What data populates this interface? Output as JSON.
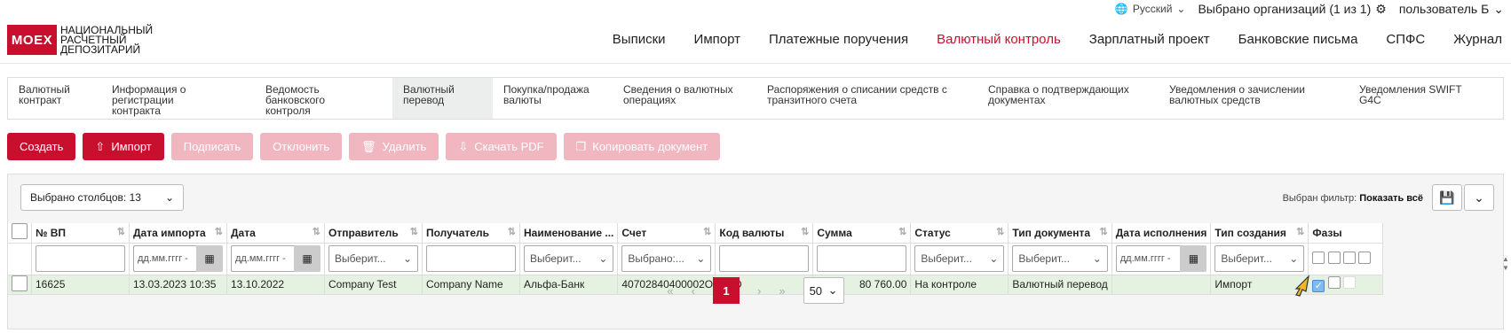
{
  "topbar": {
    "language": "Русский",
    "org_selected": "Выбрано организаций (1 из 1)",
    "user": "пользователь Б"
  },
  "logo": {
    "mark": "MOEX",
    "line1": "Национальный",
    "line2": "расчетный",
    "line3": "депозитарий"
  },
  "nav": [
    "Выписки",
    "Импорт",
    "Платежные поручения",
    "Валютный контроль",
    "Зарплатный проект",
    "Банковские письма",
    "СПФС",
    "Журнал"
  ],
  "tabs": [
    {
      "line1": "Валютный",
      "line2": "контракт"
    },
    {
      "line1": "Информация о регистрации",
      "line2": "контракта"
    },
    {
      "line1": "Ведомость банковского",
      "line2": "контроля"
    },
    {
      "line1": "Валютный",
      "line2": "перевод"
    },
    {
      "line1": "Покупка/продажа",
      "line2": "валюты"
    },
    {
      "line1": "Сведения о валютных",
      "line2": "операциях"
    },
    {
      "line1": "Распоряжения о списании средств с",
      "line2": "транзитного счета"
    },
    {
      "line1": "Справка о подтверждающих",
      "line2": "документах"
    },
    {
      "line1": "Уведомления о зачислении",
      "line2": "валютных средств"
    },
    {
      "line1": "Уведомления SWIFT",
      "line2": "G4C"
    }
  ],
  "toolbar": {
    "create": "Создать",
    "import": "Импорт",
    "sign": "Подписать",
    "reject": "Отклонить",
    "delete": "Удалить",
    "pdf": "Скачать PDF",
    "copy": "Копировать документ"
  },
  "grid": {
    "columns_selected": "Выбрано столбцов: 13",
    "filter_label": "Выбран фильтр:",
    "filter_value": "Показать всё",
    "headers": [
      "№ ВП",
      "Дата импорта",
      "Дата",
      "Отправитель",
      "Получатель",
      "Наименование ...",
      "Счет",
      "Код валюты",
      "Сумма",
      "Статус",
      "Тип документа",
      "Дата исполнения",
      "Тип создания",
      "Фазы"
    ],
    "filters": {
      "date_ph": "дд.мм.гггг -",
      "choose": "Выберит...",
      "chosen": "Выбрано:..."
    },
    "row": {
      "num": "16625",
      "import_date": "13.03.2023 10:35",
      "date": "13.10.2022",
      "sender": "Company Test",
      "receiver": "Company Name",
      "bank": "Альфа-Банк",
      "account": "40702840400002О...",
      "currency": "USD",
      "amount": "80 760.00",
      "status": "На контроле",
      "doc_type": "Валютный перевод",
      "exec_date": "",
      "creation": "Импорт"
    },
    "pager": {
      "first": "«",
      "prev": "‹",
      "current": "1",
      "next": "›",
      "last": "»",
      "page_size": "50"
    }
  },
  "colors": {
    "accent": "#c8102e",
    "row_highlight": "#e6f2e1"
  }
}
